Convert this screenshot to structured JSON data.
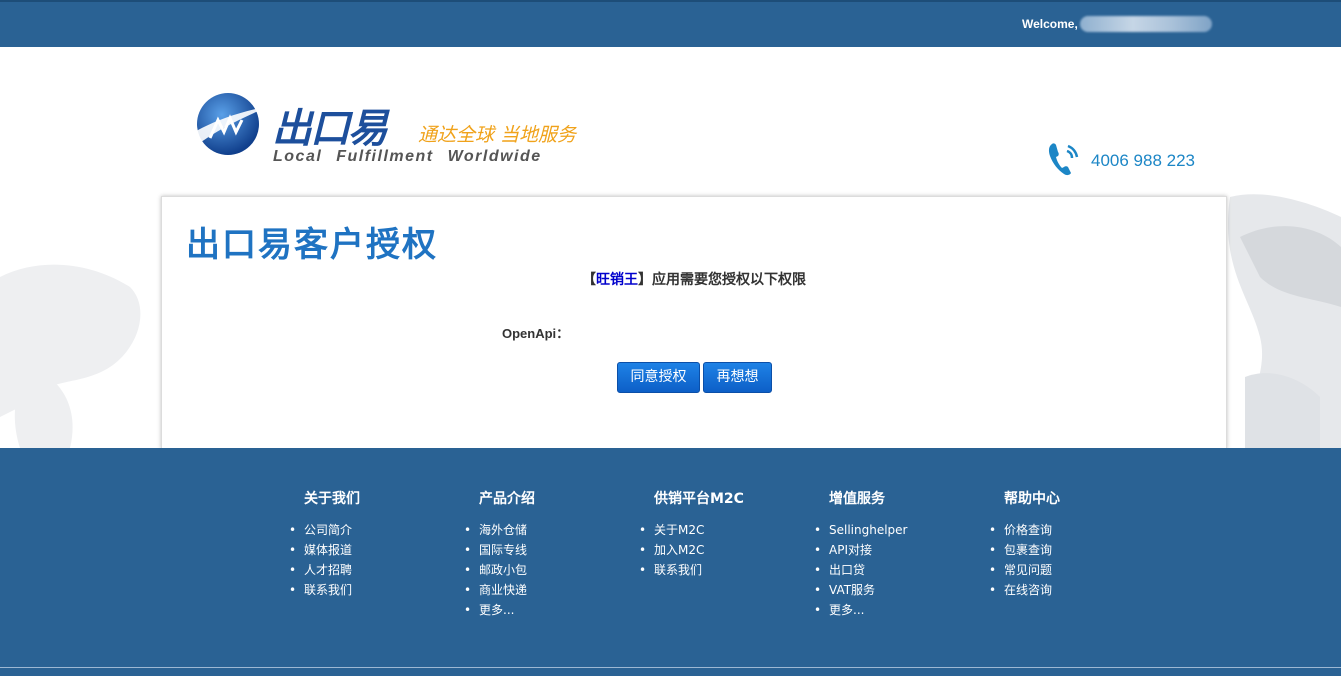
{
  "topbar": {
    "welcome": "Welcome, "
  },
  "brand": {
    "name_cn": "出口易",
    "slogan_cn": "通达全球 当地服务",
    "slogan_en": "Local Fulfillment Worldwide",
    "phone": "4006 988 223"
  },
  "card": {
    "title": "出口易客户授权",
    "bracket_open": "【",
    "app_name": "旺销王",
    "bracket_close": "】",
    "message": "应用需要您授权以下权限",
    "permission_label": "OpenApi："
  },
  "buttons": {
    "agree": "同意授权",
    "later": "再想想"
  },
  "footer": {
    "columns": [
      {
        "title": "关于我们",
        "items": [
          "公司简介",
          "媒体报道",
          "人才招聘",
          "联系我们"
        ]
      },
      {
        "title": "产品介绍",
        "items": [
          "海外仓储",
          "国际专线",
          "邮政小包",
          "商业快递",
          "更多..."
        ]
      },
      {
        "title": "供销平台M2C",
        "items": [
          "关于M2C",
          "加入M2C",
          "联系我们"
        ]
      },
      {
        "title": "增值服务",
        "items": [
          "Sellinghelper",
          "API对接",
          "出口贷",
          "VAT服务",
          "更多..."
        ]
      },
      {
        "title": "帮助中心",
        "items": [
          "价格查询",
          "包裹查询",
          "常见问题",
          "在线咨询"
        ]
      }
    ]
  },
  "colors": {
    "header_blue": "#2a6294",
    "title_blue": "#1f73c2",
    "button_blue": "#0d5fc7",
    "slogan_orange": "#f0a21a"
  }
}
